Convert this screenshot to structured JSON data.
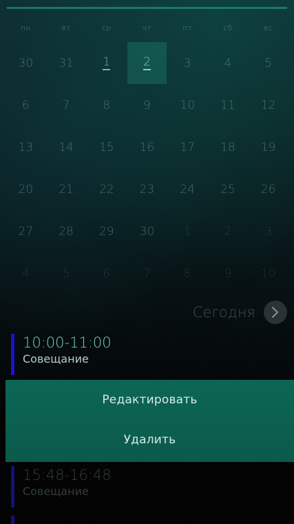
{
  "calendar": {
    "weekdays": [
      "пн",
      "вт",
      "ср",
      "чт",
      "пт",
      "сб",
      "вс"
    ],
    "weeks": [
      [
        "30",
        "31",
        "1",
        "2",
        "3",
        "4",
        "5"
      ],
      [
        "6",
        "7",
        "8",
        "9",
        "10",
        "11",
        "12"
      ],
      [
        "13",
        "14",
        "15",
        "16",
        "17",
        "18",
        "19"
      ],
      [
        "20",
        "21",
        "22",
        "23",
        "24",
        "25",
        "26"
      ],
      [
        "27",
        "28",
        "29",
        "30",
        "1",
        "2",
        "3"
      ],
      [
        "4",
        "5",
        "6",
        "7",
        "8",
        "9",
        "10"
      ]
    ],
    "selected_day": "2",
    "today_label": "Сегодня"
  },
  "events": [
    {
      "time": "10:00-11:00",
      "title": "Совещание"
    },
    {
      "time": "15:48-16:48",
      "title": "Совещание"
    }
  ],
  "menu": {
    "edit_label": "Редактировать",
    "delete_label": "Удалить"
  },
  "colors": {
    "accent": "#1aa58c",
    "event_bar": "#1a13c8",
    "menu_bg": "#0d6655"
  }
}
